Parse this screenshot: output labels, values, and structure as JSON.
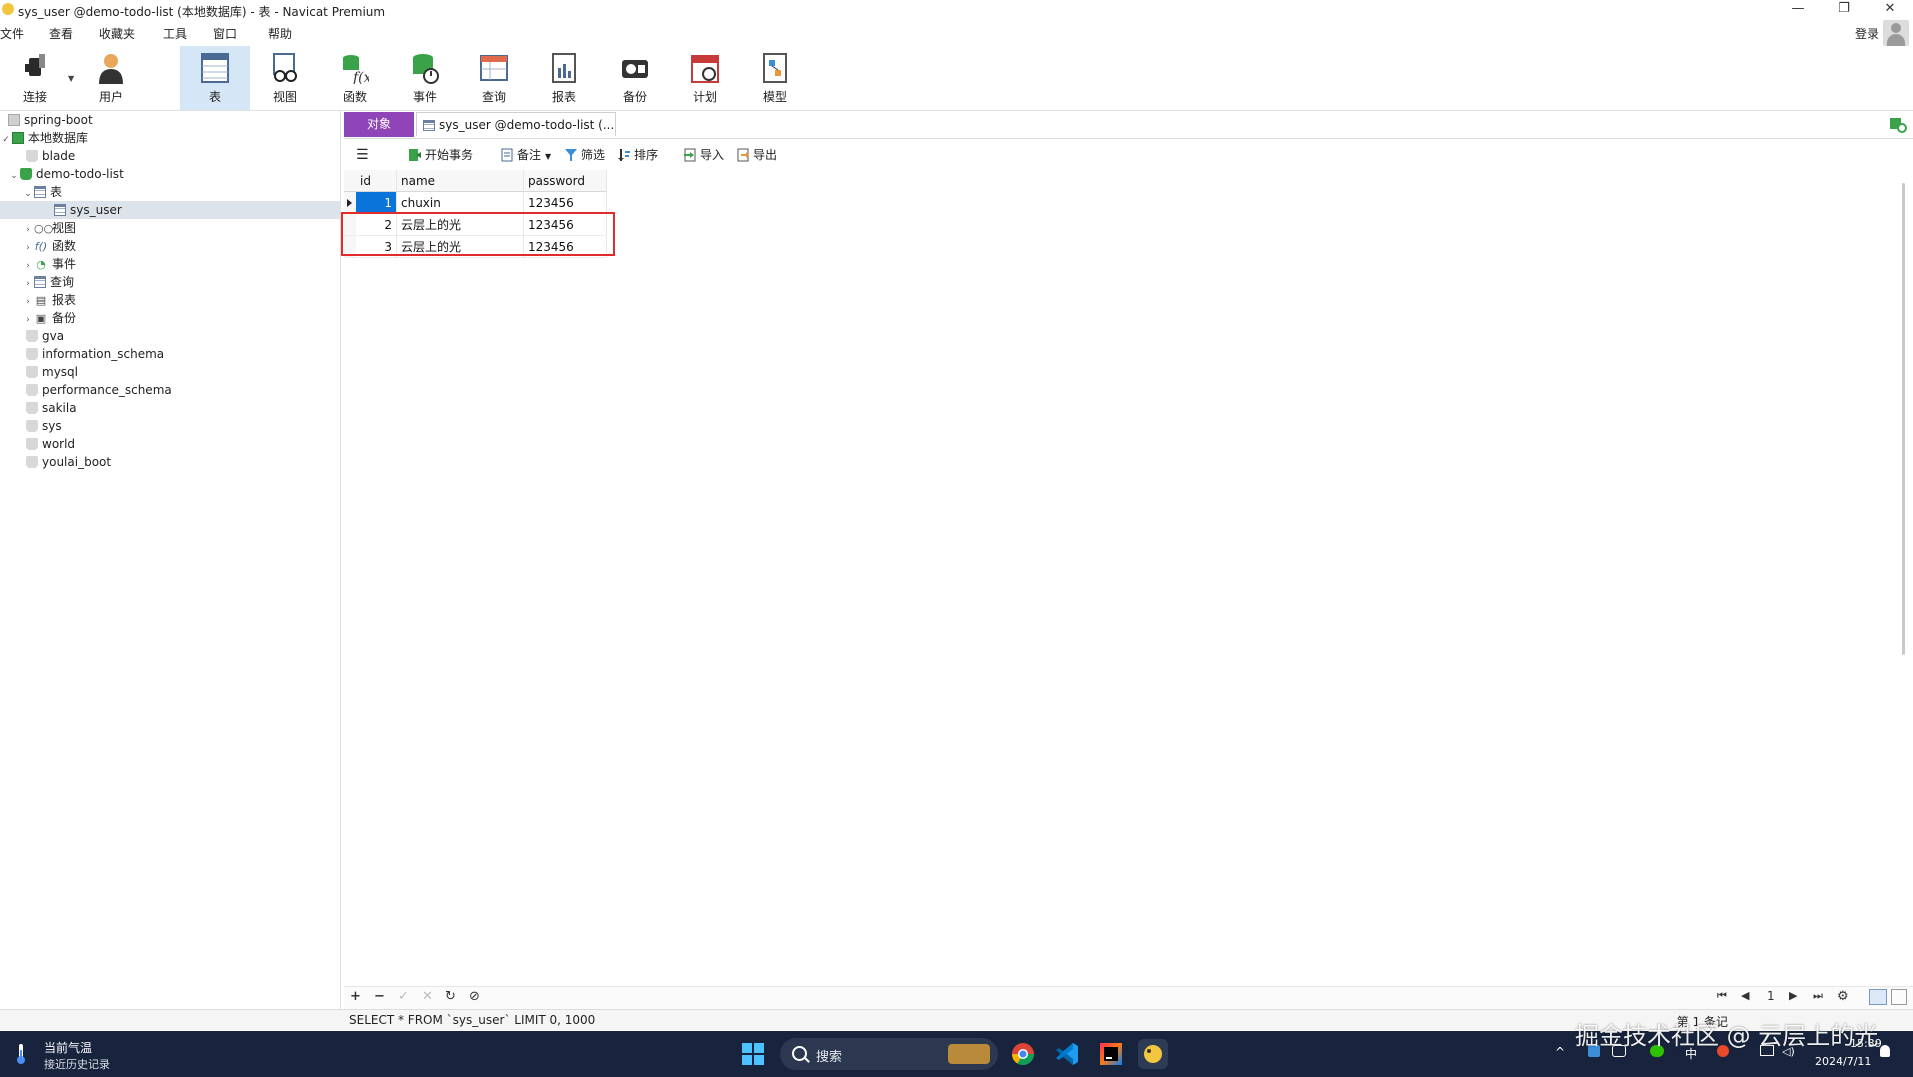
{
  "window": {
    "title": "sys_user @demo-todo-list (本地数据库) - 表 - Navicat Premium",
    "controls": {
      "minimize": "—",
      "restore": "❐",
      "close": "✕"
    }
  },
  "menu": [
    "文件",
    "查看",
    "收藏夹",
    "工具",
    "窗口",
    "帮助"
  ],
  "login_label": "登录",
  "toolbar": [
    {
      "label": "连接",
      "icon": "plug-icon"
    },
    {
      "label": "用户",
      "icon": "user-icon"
    },
    {
      "label": "表",
      "icon": "table-icon"
    },
    {
      "label": "视图",
      "icon": "view-icon"
    },
    {
      "label": "函数",
      "icon": "function-icon"
    },
    {
      "label": "事件",
      "icon": "event-icon"
    },
    {
      "label": "查询",
      "icon": "query-icon"
    },
    {
      "label": "报表",
      "icon": "report-icon"
    },
    {
      "label": "备份",
      "icon": "backup-icon"
    },
    {
      "label": "计划",
      "icon": "schedule-icon"
    },
    {
      "label": "模型",
      "icon": "model-icon"
    }
  ],
  "tree": {
    "spring_boot": "spring-boot",
    "local_db": "本地数据库",
    "blade": "blade",
    "demo_todo_list": "demo-todo-list",
    "tables": "表",
    "sys_user": "sys_user",
    "views": "视图",
    "functions": "函数",
    "events": "事件",
    "queries": "查询",
    "reports": "报表",
    "backups": "备份",
    "other_dbs": [
      "gva",
      "information_schema",
      "mysql",
      "performance_schema",
      "sakila",
      "sys",
      "world",
      "youlai_boot"
    ]
  },
  "tabs": {
    "objects": "对象",
    "active": "sys_user @demo-todo-list (..."
  },
  "grid_toolbar": {
    "menu_icon": "☰",
    "begin_transaction": "开始事务",
    "note": "备注",
    "filter": "筛选",
    "sort": "排序",
    "import": "导入",
    "export": "导出"
  },
  "table": {
    "columns": [
      "id",
      "name",
      "password"
    ],
    "rows": [
      {
        "id": "1",
        "name": "chuxin",
        "password": "123456"
      },
      {
        "id": "2",
        "name": "云层上的光",
        "password": "123456"
      },
      {
        "id": "3",
        "name": "云层上的光",
        "password": "123456"
      }
    ]
  },
  "bottom_nav": {
    "add": "+",
    "remove": "−",
    "apply": "✓",
    "cancel": "✕",
    "refresh": "↻",
    "stop": "⊘",
    "first": "⏮",
    "prev": "◀",
    "page": "1",
    "next": "▶",
    "last": "⏭",
    "settings": "⚙"
  },
  "status": {
    "sql": "SELECT * FROM `sys_user` LIMIT 0, 1000",
    "page_info": "第 1 条记"
  },
  "taskbar": {
    "weather_line1": "当前气温",
    "weather_line2": "接近历史记录",
    "search_placeholder": "搜索",
    "tray_lang": "中",
    "tray_up": "^",
    "clock_time": "15:39",
    "clock_date": "2024/7/11"
  },
  "watermark": "掘金技术社区 @ 云层上的光",
  "colors": {
    "accent": "#0a74da",
    "objects_tab": "#8f44b8",
    "highlight_box": "#e32b2b",
    "taskbar": "#18243d"
  }
}
